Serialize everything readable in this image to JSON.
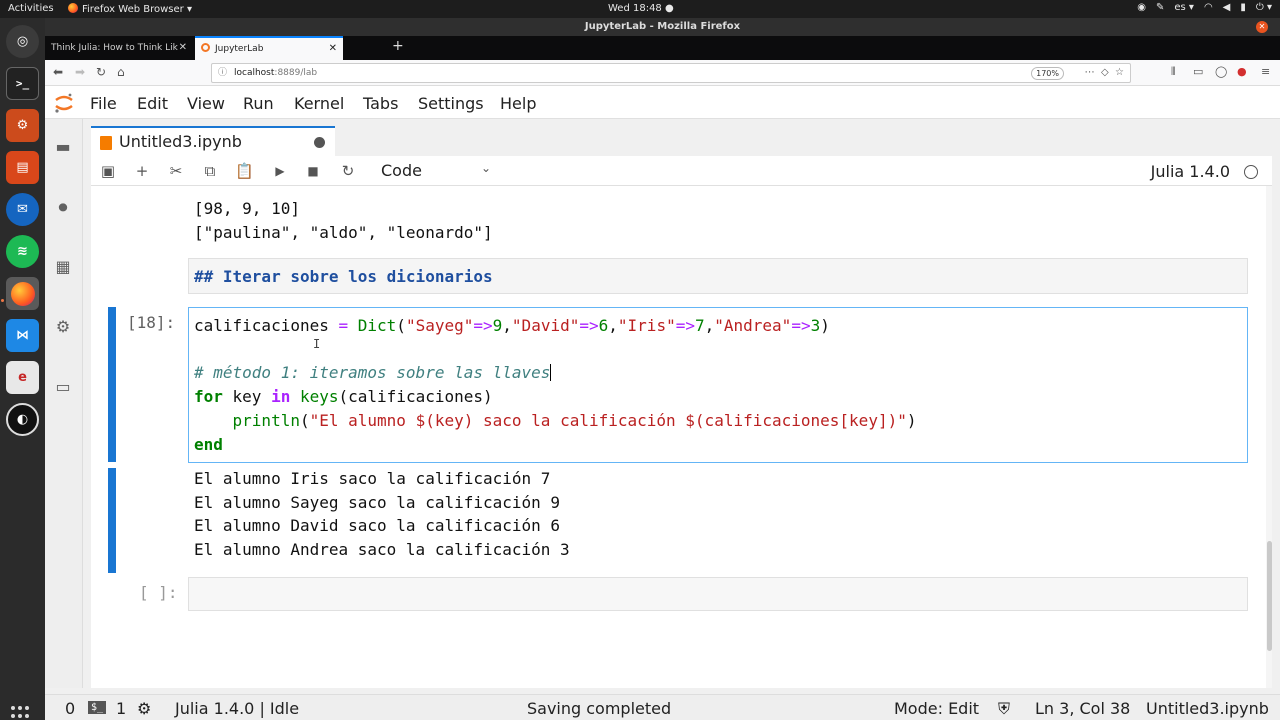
{
  "system_bar": {
    "activities": "Activities",
    "app_menu": "Firefox Web Browser",
    "clock": "Wed 18:48",
    "language": "es"
  },
  "browser": {
    "window_title": "JupyterLab - Mozilla Firefox",
    "tabs": [
      {
        "label": "Think Julia: How to Think Lik"
      },
      {
        "label": "JupyterLab"
      }
    ],
    "url_host": "localhost",
    "url_rest": ":8889/lab",
    "zoom": "170%"
  },
  "menu": {
    "items": [
      "File",
      "Edit",
      "View",
      "Run",
      "Kernel",
      "Tabs",
      "Settings",
      "Help"
    ]
  },
  "notebook": {
    "tab_title": "Untitled3.ipynb",
    "cell_type": "Code",
    "kernel": "Julia 1.4.0"
  },
  "cells": {
    "prev_output_1": "[98, 9, 10]",
    "prev_output_2": "[\"paulina\", \"aldo\", \"leonardo\"]",
    "markdown": "## Iterar sobre los dicionarios",
    "code_prompt": "[18]:",
    "code": {
      "l1_var": "calificaciones",
      "l1_eq": " = ",
      "l1_fn": "Dict",
      "l1_open": "(",
      "s_sayeg": "\"Sayeg\"",
      "arrow": "=>",
      "n9": "9",
      "s_david": "\"David\"",
      "n6": "6",
      "s_iris": "\"Iris\"",
      "n7": "7",
      "s_andrea": "\"Andrea\"",
      "n3": "3",
      "comma": ",",
      "close": ")",
      "comment": "# método 1: iteramos sobre las llaves",
      "kw_for": "for",
      "l3_key": " key ",
      "kw_in": "in",
      "l3_keys_fn": "keys",
      "l3_rest": "(calificaciones)",
      "l4_indent": "    ",
      "l4_fn": "println",
      "l4_open": "(",
      "l4_str": "\"El alumno $(key) saco la calificación $(calificaciones[key])\"",
      "l4_close": ")",
      "kw_end": "end"
    },
    "outputs": [
      "El alumno Iris saco la calificación 7",
      "El alumno Sayeg saco la calificación 9",
      "El alumno David saco la calificación 6",
      "El alumno Andrea saco la calificación 3"
    ],
    "empty_prompt": "[ ]:"
  },
  "statusbar": {
    "terminals": "0",
    "consoles": "1",
    "kernel_status": "Julia 1.4.0 | Idle",
    "message": "Saving completed",
    "mode": "Mode: Edit",
    "cursor": "Ln 3, Col 38",
    "file": "Untitled3.ipynb"
  },
  "colors": {
    "accent": "#1976d2",
    "brand": "#f37726"
  }
}
